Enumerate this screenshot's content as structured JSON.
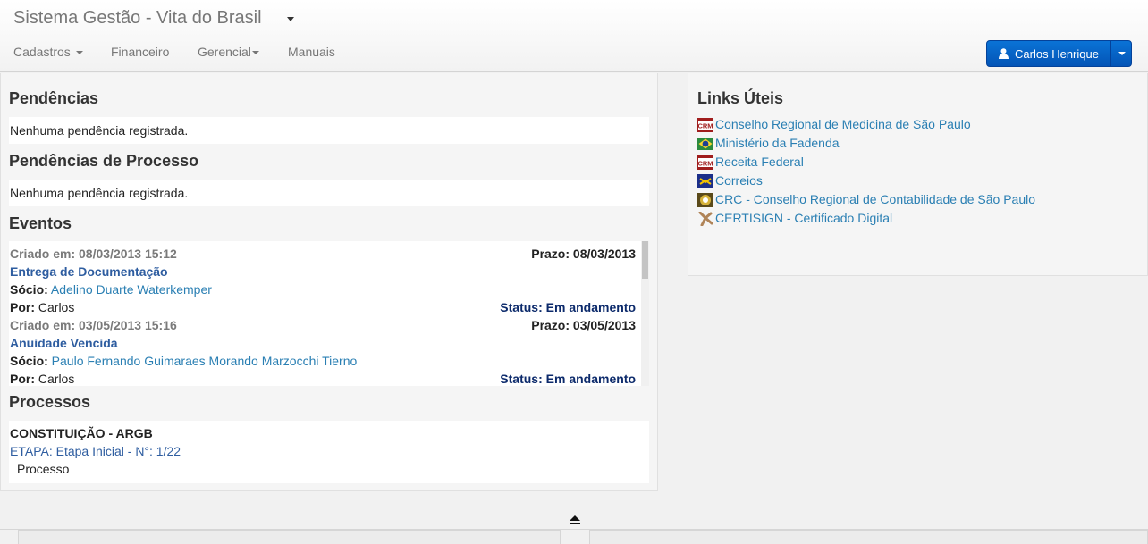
{
  "header": {
    "brand": "Sistema Gestão - Vita do Brasil",
    "nav": [
      "Cadastros",
      "Financeiro",
      "Gerencial",
      "Manuais"
    ],
    "user_name": "Carlos Henrique"
  },
  "pendencias": {
    "title": "Pendências",
    "message": "Nenhuma pendência registrada."
  },
  "pendencias_processo": {
    "title": "Pendências de Processo",
    "message": "Nenhuma pendência registrada."
  },
  "eventos": {
    "title": "Eventos",
    "items": [
      {
        "criado_label": "Criado em:",
        "criado": "08/03/2013 15:12",
        "prazo_label": "Prazo:",
        "prazo": "08/03/2013",
        "titulo": "Entrega de Documentação",
        "socio_label": "Sócio:",
        "socio": "Adelino Duarte Waterkemper",
        "por_label": "Por:",
        "por": "Carlos",
        "status_label": "Status:",
        "status": "Em andamento"
      },
      {
        "criado_label": "Criado em:",
        "criado": "03/05/2013 15:16",
        "prazo_label": "Prazo:",
        "prazo": "03/05/2013",
        "titulo": "Anuidade Vencida",
        "socio_label": "Sócio:",
        "socio": "Paulo Fernando Guimaraes Morando Marzocchi Tierno",
        "por_label": "Por:",
        "por": "Carlos",
        "status_label": "Status:",
        "status": "Em andamento"
      }
    ]
  },
  "processos": {
    "title": "Processos",
    "name": "CONSTITUIÇÃO - ARGB",
    "etapa": "ETAPA: Etapa Inicial - N°: 1/22",
    "link": "Processo"
  },
  "links_uteis": {
    "title": "Links Úteis",
    "items": [
      {
        "label": "Conselho Regional de Medicina de São Paulo",
        "icon": "crm-icon"
      },
      {
        "label": "Ministério da Fadenda",
        "icon": "brazil-flag-icon"
      },
      {
        "label": "Receita Federal",
        "icon": "crm-icon"
      },
      {
        "label": "Correios",
        "icon": "correios-icon"
      },
      {
        "label": "CRC - Conselho Regional de Contabilidade de São Paulo",
        "icon": "crc-icon"
      },
      {
        "label": "CERTISIGN - Certificado Digital",
        "icon": "certisign-icon"
      }
    ],
    "icon_text": "CRM"
  },
  "colors": {
    "primary_button": "#0a73d6",
    "link": "#2a7fb3",
    "status": "#0c2a6b",
    "event_title": "#2e5da0"
  }
}
